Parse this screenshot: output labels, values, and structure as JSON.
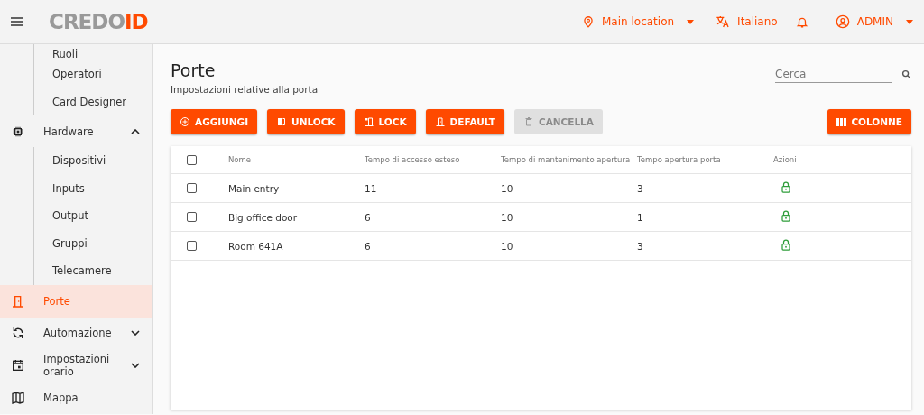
{
  "header": {
    "logo": {
      "part_1": "CREDO",
      "part_2": "ID"
    },
    "location": "Main location",
    "language": "Italiano",
    "user": "ADMIN"
  },
  "sidebar": {
    "items": [
      {
        "kind": "sub",
        "label": "Ruoli",
        "selected": false
      },
      {
        "kind": "sub",
        "label": "Operatori",
        "selected": false
      },
      {
        "kind": "sub",
        "label": "Card Designer",
        "selected": false
      },
      {
        "kind": "group",
        "label": "Hardware",
        "expanded": true,
        "children": [
          {
            "label": "Dispositivi",
            "selected": false
          },
          {
            "label": "Inputs",
            "selected": false
          },
          {
            "label": "Output",
            "selected": false
          },
          {
            "label": "Gruppi",
            "selected": false
          },
          {
            "label": "Telecamere",
            "selected": false
          }
        ]
      },
      {
        "kind": "link",
        "label": "Porte",
        "selected": true
      },
      {
        "kind": "group",
        "label": "Automazione",
        "expanded": false
      },
      {
        "kind": "group",
        "label": "Impostazioni orario",
        "expanded": false
      },
      {
        "kind": "link",
        "label": "Mappa",
        "selected": false
      }
    ]
  },
  "page": {
    "title": "Porte",
    "subtitle": "Impostazioni relative alla porta",
    "search": {
      "placeholder": "Cerca"
    }
  },
  "toolbar": [
    {
      "label": "AGGIUNGI",
      "disabled": false
    },
    {
      "label": "UNLOCK",
      "disabled": false
    },
    {
      "label": "LOCK",
      "disabled": false
    },
    {
      "label": "DEFAULT",
      "disabled": false
    },
    {
      "label": "CANCELLA",
      "disabled": true
    }
  ],
  "columns_button": {
    "label": "COLONNE"
  },
  "table": {
    "all_selected": false,
    "columns": [
      "Nome",
      "Tempo di accesso esteso",
      "Tempo di mantenimento apertura",
      "Tempo apertura porta",
      "Azioni"
    ],
    "rows": [
      {
        "selected": false,
        "cells": [
          "Main entry",
          "11",
          "10",
          "3"
        ],
        "locked": true
      },
      {
        "selected": false,
        "cells": [
          "Big office door",
          "6",
          "10",
          "1"
        ],
        "locked": true
      },
      {
        "selected": false,
        "cells": [
          "Room 641A",
          "6",
          "10",
          "3"
        ],
        "locked": true
      }
    ]
  }
}
